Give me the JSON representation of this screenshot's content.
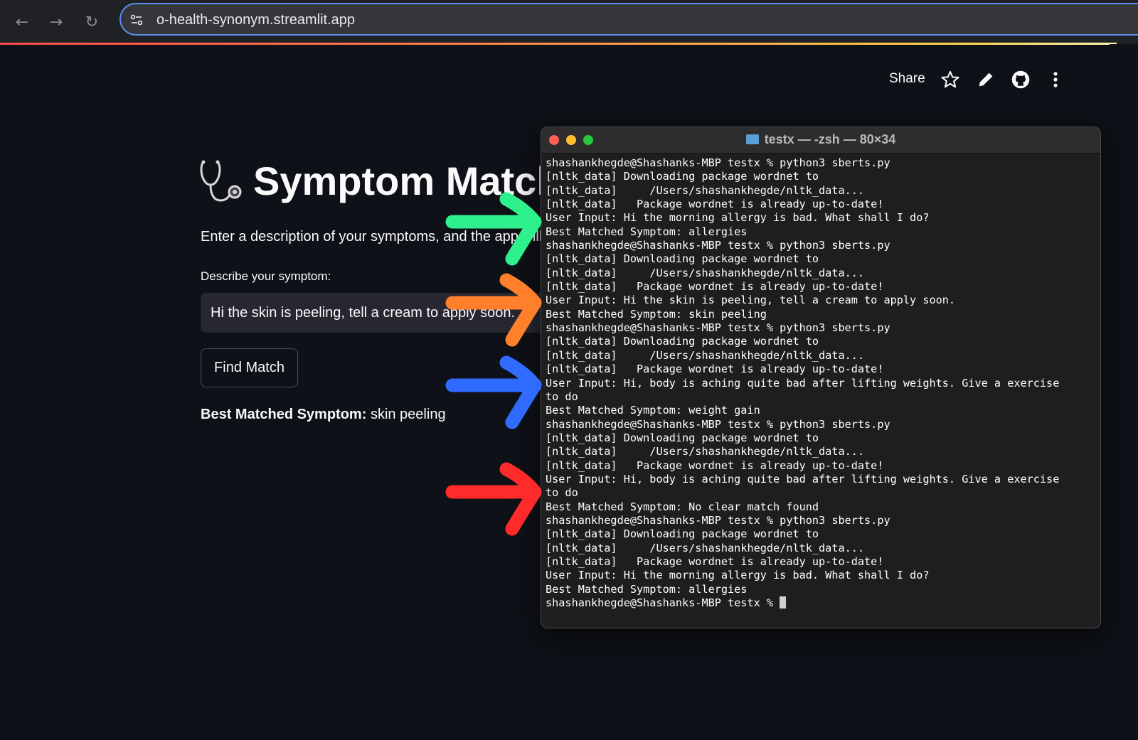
{
  "browser": {
    "url": "o-health-synonym.streamlit.app"
  },
  "app_header": {
    "share_label": "Share"
  },
  "app": {
    "title": "Symptom Match",
    "description": "Enter a description of your symptoms, and the app will find the best match.",
    "input_label": "Describe your symptom:",
    "input_value": "Hi the skin is peeling, tell a cream to apply soon.",
    "button_label": "Find Match",
    "result_label": "Best Matched Symptom:",
    "result_value": "skin peeling"
  },
  "terminal": {
    "title": "testx — -zsh — 80×34",
    "lines": [
      "shashankhegde@Shashanks-MBP testx % python3 sberts.py",
      "[nltk_data] Downloading package wordnet to",
      "[nltk_data]     /Users/shashankhegde/nltk_data...",
      "[nltk_data]   Package wordnet is already up-to-date!",
      "User Input: Hi the morning allergy is bad. What shall I do?",
      "Best Matched Symptom: allergies",
      "shashankhegde@Shashanks-MBP testx % python3 sberts.py",
      "[nltk_data] Downloading package wordnet to",
      "[nltk_data]     /Users/shashankhegde/nltk_data...",
      "[nltk_data]   Package wordnet is already up-to-date!",
      "User Input: Hi the skin is peeling, tell a cream to apply soon.",
      "Best Matched Symptom: skin peeling",
      "shashankhegde@Shashanks-MBP testx % python3 sberts.py",
      "[nltk_data] Downloading package wordnet to",
      "[nltk_data]     /Users/shashankhegde/nltk_data...",
      "[nltk_data]   Package wordnet is already up-to-date!",
      "User Input: Hi, body is aching quite bad after lifting weights. Give a exercise",
      "to do",
      "Best Matched Symptom: weight gain",
      "shashankhegde@Shashanks-MBP testx % python3 sberts.py",
      "[nltk_data] Downloading package wordnet to",
      "[nltk_data]     /Users/shashankhegde/nltk_data...",
      "[nltk_data]   Package wordnet is already up-to-date!",
      "User Input: Hi, body is aching quite bad after lifting weights. Give a exercise",
      "to do",
      "Best Matched Symptom: No clear match found",
      "shashankhegde@Shashanks-MBP testx % python3 sberts.py",
      "[nltk_data] Downloading package wordnet to",
      "[nltk_data]     /Users/shashankhegde/nltk_data...",
      "[nltk_data]   Package wordnet is already up-to-date!",
      "User Input: Hi the morning allergy is bad. What shall I do?",
      "Best Matched Symptom: allergies",
      "shashankhegde@Shashanks-MBP testx % "
    ]
  },
  "annotation_arrows": [
    {
      "color": "#2ef08c"
    },
    {
      "color": "#ff7f2a"
    },
    {
      "color": "#2f6bff"
    },
    {
      "color": "#ff2a2a"
    }
  ]
}
